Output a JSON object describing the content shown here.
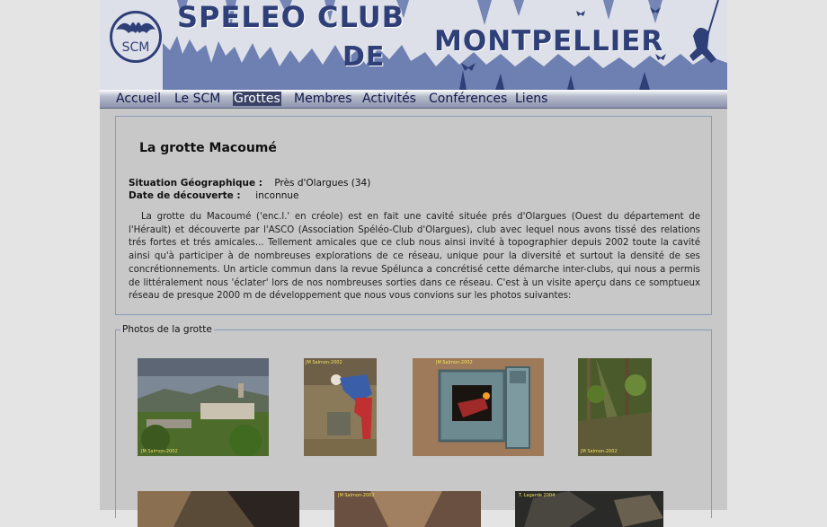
{
  "header": {
    "title_line1": "SPELEO CLUB",
    "title_line2": "DE",
    "title_line3": "MONTPELLIER",
    "logo_text": "SCM"
  },
  "nav": [
    "Accueil",
    "Le SCM",
    "Grottes",
    "Membres",
    "Activités",
    "Conférences",
    "Liens"
  ],
  "nav_active": "Grottes",
  "cave": {
    "title": "La grotte Macoumé",
    "situation_label": "Situation Géographique :",
    "situation_value": "Près d'Olargues (34)",
    "date_label": "Date de découverte :",
    "date_value": "inconnue",
    "description": "La grotte du Macoumé ('enc.l.' en créole) est en fait une cavité située prés d'Olargues (Ouest du département de l'Hérault) et découverte par l'ASCO (Association Spéléo-Club d'Olargues), club avec lequel nous avons tissé des relations trés fortes et trés amicales... Tellement amicales que ce club nous ainsi invité à topographier depuis 2002 toute la cavité ainsi qu'à participer à de nombreuses explorations de ce réseau, unique pour la diversité et surtout la densité de ses concrétionnements. Un article commun dans la revue Spélunca a concrétisé cette démarche inter-clubs, qui nous a permis de littéralement nous 'éclater' lors de nos nombreuses sorties dans ce réseau. C'est à un visite aperçu dans ce somptueux réseau de presque 2000 m de développement que nous vous convions sur les photos suivantes:"
  },
  "photos": {
    "legend": "Photos de la grotte",
    "credits": [
      "JM Salmon-2002",
      "JM Salmon-2002",
      "JM Salmon-2002",
      "JM Salmon-2002",
      "JM Salmon-2002",
      "T. Lagarde 2004"
    ]
  },
  "colors": {
    "page_bg": "#c8c8c8",
    "outer_bg": "#e4e4e4",
    "banner_blue": "#2f3f78",
    "box_border": "#8a9ab8",
    "nav_active_bg": "#3a4366"
  }
}
